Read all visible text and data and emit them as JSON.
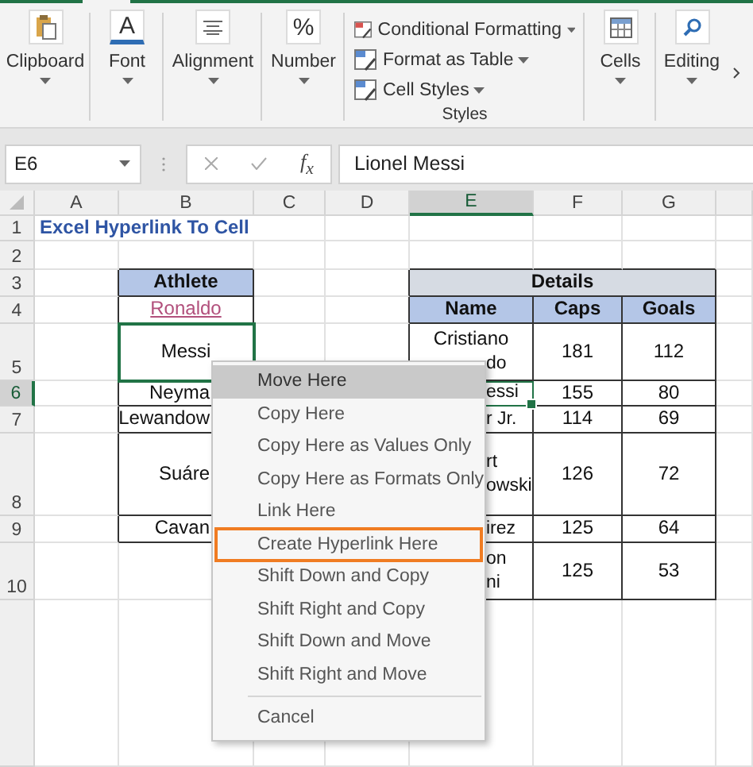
{
  "ribbon": {
    "groups": [
      {
        "kind": "big",
        "label": "Clipboard"
      },
      {
        "kind": "big",
        "label": "Font",
        "icon_text": "A"
      },
      {
        "kind": "big",
        "label": "Alignment"
      },
      {
        "kind": "big",
        "label": "Number",
        "icon_text": "%"
      },
      {
        "kind": "stack",
        "label": "Styles",
        "items": [
          "Conditional Formatting",
          "Format as Table",
          "Cell Styles"
        ]
      },
      {
        "kind": "big",
        "label": "Cells"
      },
      {
        "kind": "big",
        "label": "Editing"
      }
    ]
  },
  "formula_bar": {
    "name_box": "E6",
    "function_label": "f$_{x}$",
    "formula": "Lionel Messi"
  },
  "sheet": {
    "columns": [
      {
        "label": "A",
        "selected": false
      },
      {
        "label": "B",
        "selected": false
      },
      {
        "label": "C",
        "selected": false
      },
      {
        "label": "D",
        "selected": false
      },
      {
        "label": "E",
        "selected": true
      },
      {
        "label": "F",
        "selected": false
      },
      {
        "label": "G",
        "selected": false
      }
    ],
    "rows": [
      {
        "label": "1",
        "selected": false
      },
      {
        "label": "2",
        "selected": false
      },
      {
        "label": "3",
        "selected": false
      },
      {
        "label": "4",
        "selected": false
      },
      {
        "label": "5",
        "selected": false
      },
      {
        "label": "6",
        "selected": true
      },
      {
        "label": "7",
        "selected": false
      },
      {
        "label": "8",
        "selected": false
      },
      {
        "label": "9",
        "selected": false
      },
      {
        "label": "10",
        "selected": false
      }
    ],
    "title": "Excel Hyperlink To Cell"
  },
  "athlete_table": {
    "header": "Athlete",
    "rows": [
      {
        "text": "Ronaldo",
        "kind": "link",
        "selected": false,
        "cut": false
      },
      {
        "text": "Messi",
        "kind": "plain",
        "selected": true,
        "cut": false
      },
      {
        "text": "Neyma",
        "kind": "plain",
        "selected": false,
        "cut": true
      },
      {
        "text": "Lewandow",
        "kind": "plain",
        "selected": false,
        "cut": true
      },
      {
        "text": "Suáre",
        "kind": "plain",
        "selected": false,
        "cut": true
      },
      {
        "text": "Cavan",
        "kind": "plain",
        "selected": false,
        "cut": true
      }
    ]
  },
  "details_table": {
    "title": "Details",
    "columns": [
      "Name",
      "Caps",
      "Goals"
    ],
    "rows": [
      {
        "name": [
          {
            "text": "Cristiano",
            "cut": false
          },
          {
            "text": "do",
            "cut": true
          }
        ],
        "caps": "181",
        "goals": "112",
        "selected": false
      },
      {
        "name": [
          {
            "text": "essi",
            "cut": true
          }
        ],
        "caps": "155",
        "goals": "80",
        "selected": true
      },
      {
        "name": [
          {
            "text": "r Jr.",
            "cut": true
          }
        ],
        "caps": "114",
        "goals": "69",
        "selected": false
      },
      {
        "name": [
          {
            "text": "rt",
            "cut": true
          },
          {
            "text": "owski",
            "cut": true
          }
        ],
        "caps": "126",
        "goals": "72",
        "selected": false
      },
      {
        "name": [
          {
            "text": "irez",
            "cut": true
          }
        ],
        "caps": "125",
        "goals": "64",
        "selected": false
      },
      {
        "name": [
          {
            "text": "on",
            "cut": true
          },
          {
            "text": "ni",
            "cut": true
          }
        ],
        "caps": "125",
        "goals": "53",
        "selected": false
      }
    ]
  },
  "context_menu": {
    "items": [
      {
        "kind": "item",
        "label": "Move Here",
        "highlighted": true,
        "outlined": false
      },
      {
        "kind": "item",
        "label": "Copy Here",
        "highlighted": false,
        "outlined": false
      },
      {
        "kind": "item",
        "label": "Copy Here as Values Only",
        "highlighted": false,
        "outlined": false
      },
      {
        "kind": "item",
        "label": "Copy Here as Formats Only",
        "highlighted": false,
        "outlined": false
      },
      {
        "kind": "item",
        "label": "Link Here",
        "highlighted": false,
        "outlined": false
      },
      {
        "kind": "item",
        "label": "Create Hyperlink Here",
        "highlighted": false,
        "outlined": true
      },
      {
        "kind": "item",
        "label": "Shift Down and Copy",
        "highlighted": false,
        "outlined": false
      },
      {
        "kind": "item",
        "label": "Shift Right and Copy",
        "highlighted": false,
        "outlined": false
      },
      {
        "kind": "item",
        "label": "Shift Down and Move",
        "highlighted": false,
        "outlined": false
      },
      {
        "kind": "item",
        "label": "Shift Right and Move",
        "highlighted": false,
        "outlined": false
      },
      {
        "kind": "separator"
      },
      {
        "kind": "item",
        "label": "Cancel",
        "highlighted": false,
        "outlined": false
      }
    ]
  }
}
